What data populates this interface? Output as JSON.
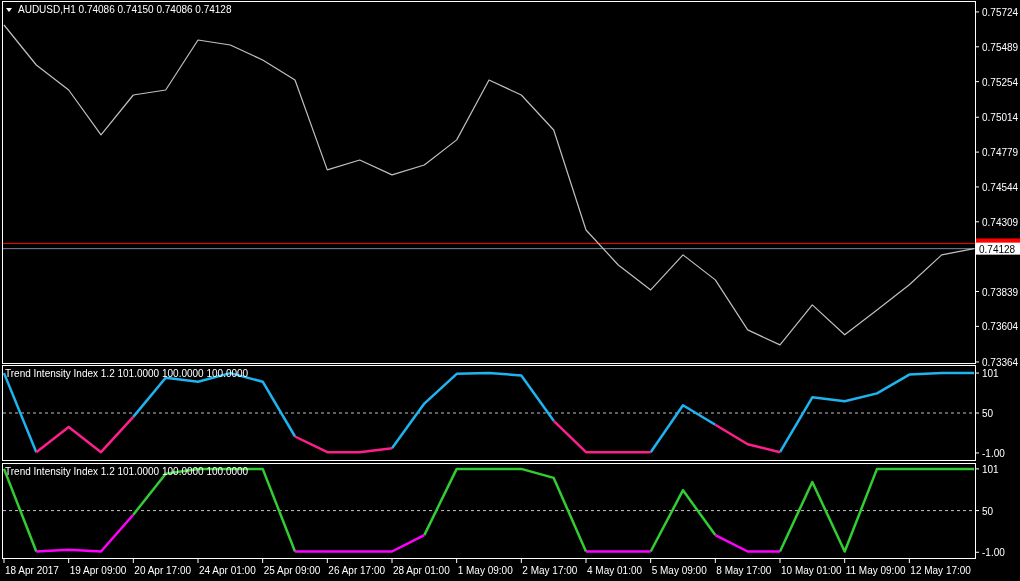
{
  "main_chart": {
    "title": "AUDUSD,H1  0.74086 0.74150 0.74086 0.74128",
    "chart_data": {
      "type": "line",
      "categories": [
        null,
        null,
        null,
        null,
        null,
        null,
        null,
        null,
        null,
        null,
        null,
        null,
        null,
        null,
        null,
        null,
        null,
        null,
        null,
        null,
        null,
        null,
        null,
        null,
        null,
        null,
        null,
        null,
        null,
        null,
        null
      ],
      "series": [
        {
          "color": "#c0c0c0",
          "values": [
            0.75636,
            0.75366,
            0.75198,
            0.74895,
            0.75164,
            0.75198,
            0.75535,
            0.75501,
            0.754,
            0.75265,
            0.74659,
            0.74726,
            0.74625,
            0.74692,
            0.74861,
            0.75265,
            0.75164,
            0.74928,
            0.74254,
            0.74018,
            0.7385,
            0.74086,
            0.73917,
            0.7358,
            0.73479,
            0.73749,
            0.73547,
            0.73715,
            0.73884,
            0.74086,
            0.74128
          ]
        }
      ],
      "ylim": [
        0.73357,
        0.75791
      ],
      "yticks": [
        {
          "value": 0.75724,
          "label": "0.75724"
        },
        {
          "value": 0.75489,
          "label": "0.75489"
        },
        {
          "value": 0.75254,
          "label": "0.75254"
        },
        {
          "value": 0.75014,
          "label": "0.75014"
        },
        {
          "value": 0.74779,
          "label": "0.74779"
        },
        {
          "value": 0.74544,
          "label": "0.74544"
        },
        {
          "value": 0.74309,
          "label": "0.74309"
        },
        {
          "value": 0.73839,
          "label": "0.73839"
        },
        {
          "value": 0.73604,
          "label": "0.73604"
        },
        {
          "value": 0.73364,
          "label": "0.73364"
        }
      ],
      "ref_lines": [
        {
          "axis": "y",
          "value": 0.74163,
          "color": "#ff0000"
        },
        {
          "axis": "y",
          "value": 0.74128,
          "color": "#778899",
          "label": "0.74128"
        }
      ]
    }
  },
  "indicator_panes": [
    {
      "title": "Trend Intensity Index 1.2 101.0000 100.0000 100.0000",
      "chart_data": {
        "type": "line",
        "categories": [
          null,
          null,
          null,
          null,
          null,
          null,
          null,
          null,
          null,
          null,
          null,
          null,
          null,
          null,
          null,
          null,
          null,
          null,
          null,
          null,
          null,
          null,
          null,
          null,
          null,
          null,
          null,
          null,
          null,
          null,
          null
        ],
        "series": [
          {
            "color": "#1eb4f0",
            "values": [
              101,
              0,
              null,
              null,
              45,
              95,
              90,
              101,
              90,
              20,
              null,
              null,
              5,
              62,
              100,
              101,
              98,
              40,
              null,
              null,
              0,
              60,
              35,
              null,
              0,
              70,
              65,
              75,
              99,
              101,
              101
            ]
          },
          {
            "color": "#ff1e8c",
            "values": [
              null,
              0,
              32,
              0,
              45,
              null,
              null,
              null,
              null,
              20,
              0,
              0,
              5,
              null,
              null,
              null,
              null,
              40,
              0,
              0,
              0,
              null,
              35,
              10,
              0,
              null,
              null,
              null,
              null,
              null,
              null
            ]
          }
        ],
        "ylim": [
          -10,
          110
        ],
        "yticks": [
          {
            "value": 101,
            "label": "101"
          },
          {
            "value": 50,
            "label": "50"
          },
          {
            "value": -1,
            "label": "-1.00"
          }
        ],
        "ref_lines": [
          {
            "axis": "y",
            "value": 50,
            "color": "#c0c0c0"
          }
        ]
      }
    },
    {
      "title": "Trend Intensity Index 1.2 101.0000 100.0000 100.0000",
      "chart_data": {
        "type": "line",
        "categories": [
          null,
          null,
          null,
          null,
          null,
          null,
          null,
          null,
          null,
          null,
          null,
          null,
          null,
          null,
          null,
          null,
          null,
          null,
          null,
          null,
          null,
          null,
          null,
          null,
          null,
          null,
          null,
          null,
          null,
          null,
          null
        ],
        "series": [
          {
            "color": "#32cd32",
            "values": [
              101,
              0,
              null,
              null,
              45,
              95,
              101,
              101,
              101,
              0,
              null,
              null,
              null,
              20,
              101,
              101,
              101,
              90,
              0,
              null,
              0,
              75,
              20,
              null,
              0,
              85,
              0,
              101,
              101,
              101,
              101
            ]
          },
          {
            "color": "#ff00ff",
            "values": [
              null,
              0,
              2,
              0,
              45,
              null,
              null,
              null,
              null,
              0,
              0,
              0,
              0,
              20,
              null,
              null,
              null,
              null,
              0,
              0,
              0,
              null,
              20,
              0,
              0,
              null,
              null,
              null,
              null,
              null,
              null
            ]
          }
        ],
        "ylim": [
          -8,
          107
        ],
        "yticks": [
          {
            "value": 101,
            "label": "101"
          },
          {
            "value": 50,
            "label": "50"
          },
          {
            "value": -1,
            "label": "-1.00"
          }
        ],
        "ref_lines": [
          {
            "axis": "y",
            "value": 50,
            "color": "#c0c0c0"
          }
        ]
      }
    }
  ],
  "time_axis": {
    "labels": [
      "18 Apr 2017",
      "19 Apr 09:00",
      "20 Apr 17:00",
      "24 Apr 01:00",
      "25 Apr 09:00",
      "26 Apr 17:00",
      "28 Apr 01:00",
      "1 May 09:00",
      "2 May 17:00",
      "4 May 01:00",
      "5 May 09:00",
      "8 May 17:00",
      "10 May 01:00",
      "11 May 09:00",
      "12 May 17:00"
    ]
  }
}
